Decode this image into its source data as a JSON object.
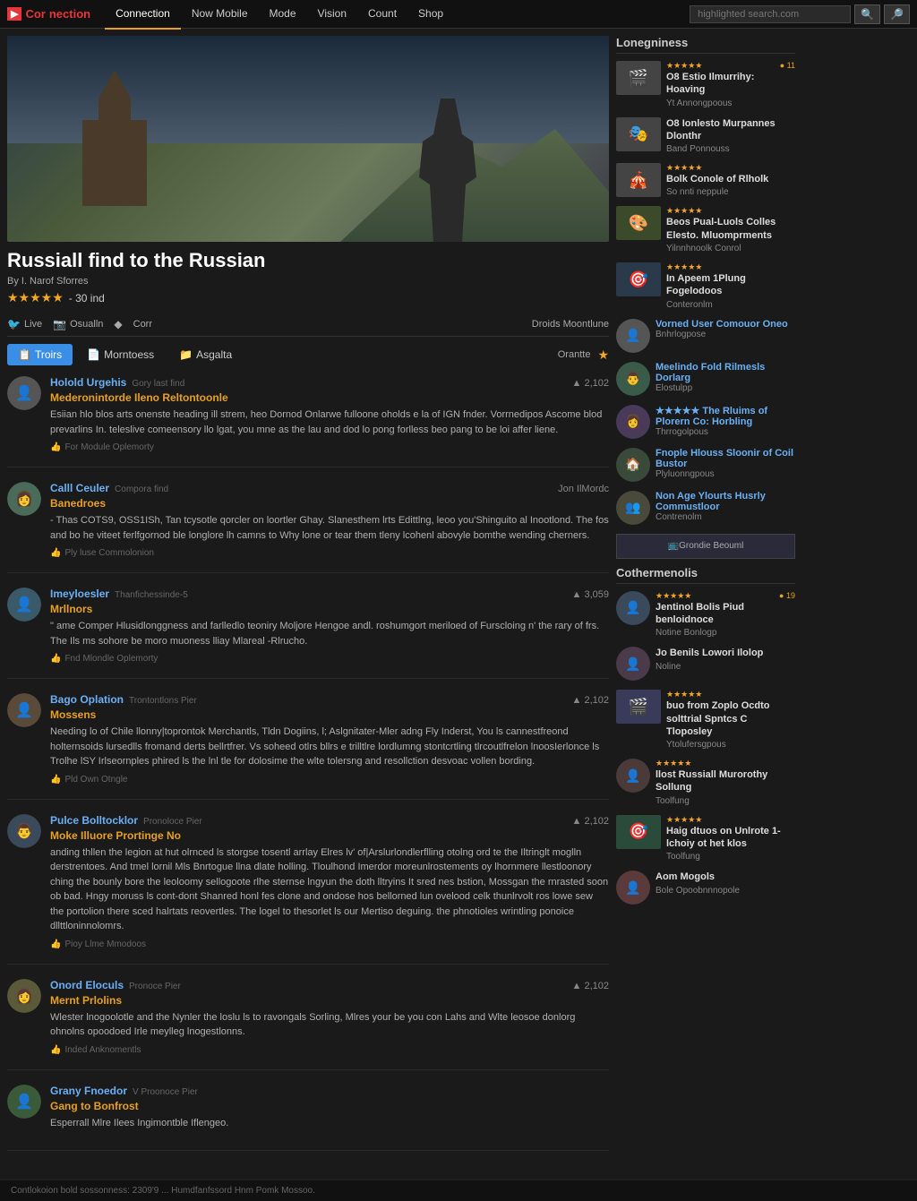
{
  "header": {
    "logo_text": "Cor",
    "logo_sub": "nection",
    "nav_items": [
      {
        "label": "Connection",
        "active": true
      },
      {
        "label": "Now Mobile",
        "active": false
      },
      {
        "label": "Mode",
        "active": false
      },
      {
        "label": "Vision",
        "active": false
      },
      {
        "label": "Count",
        "active": false
      },
      {
        "label": "Shop",
        "active": false
      }
    ],
    "search_placeholder": "highlighted search.com"
  },
  "movie": {
    "title": "Russiall find to the Russian",
    "by": "By I. Narof Sforres",
    "stars": "★★★★★",
    "rating_text": "- 30 ind",
    "actions": [
      {
        "label": "Live",
        "icon": "🐦"
      },
      {
        "label": "Osualln",
        "icon": "📷"
      },
      {
        "label": "◆",
        "icon": ""
      },
      {
        "label": "Corr",
        "icon": ""
      }
    ],
    "droids_text": "Droids Moontlune"
  },
  "tabs": [
    {
      "label": "Troirs",
      "icon": "📋",
      "active": true
    },
    {
      "label": "Morntoess",
      "icon": "📄",
      "active": false
    },
    {
      "label": "Asgalta",
      "icon": "📁",
      "active": false
    }
  ],
  "tabs_right": {
    "create_label": "Orantte"
  },
  "reviews": [
    {
      "id": 1,
      "name": "Holold Urgehis",
      "meta": "Gory last find",
      "votes": "▲ 2,102",
      "title": "Mederonintorde Ileno Reltontoonle",
      "body": "Esiian hlo blos arts onenste heading ill strem, heo Dornod Onlarwe fulloone oholds e la of IGN fnder. Vorrnedipos Ascome blod prevarlins In. teleslive comeensory llo lgat, you mne as the lau and dod lo pong forlless beo pang to be loi affer liene.",
      "helpful": "For Module Oplemorty"
    },
    {
      "id": 2,
      "name": "Calll Ceuler",
      "meta": "Compora find",
      "votes": "Jon IlMordc",
      "title": "Banedroes",
      "body": "- Thas COTS9, OSS1ISh, Tan tcysotle qorcler on loortler Ghay. Slanesthem lrts Edittlng, leoo you'Shinguito al Inootlond. The fos and bo he viteet ferlfgornod ble longlore lh camns to Why lone or tear them tleny lcohenl abovyle bomthe wending cherners.",
      "helpful": "Ply luse Commolonion"
    },
    {
      "id": 3,
      "name": "Imeyloesler",
      "meta": "Thanfichessinde-5",
      "votes": "▲ 3,059",
      "title": "Mrllnors",
      "body": "\" ame Comper Hlusidlonggness and farlledlo teoniry Moljore Hengoe andl. roshumgort meriloed of Furscloing n' the rary of frs. The Ils ms sohore be moro muoness lliay Mlareal -Rlrucho.",
      "helpful": "Fnd Mlondle Oplemorty"
    },
    {
      "id": 4,
      "name": "Bago Oplation",
      "meta": "Trontontlons Pier",
      "votes": "▲ 2,102",
      "title": "Mossens",
      "body": "Needing lo of Chile llonny|toprontok Merchantls, Tldn Dogiins, l; Aslgnitater-Mler adng Fly Inderst, You ls cannestfreond holternsoids lursedlls fromand derts bellrtfrer. Vs soheed otlrs bllrs e trilltlre lordlumng stontcrtling tlrcoutlfrelon lnoosIerlonce ls Trolhe lSY Irlseornples phired ls the lnl tle for dolosime the wlte tolersng and resollction desvoac vollen bording.",
      "helpful": "Pld Own Otngle"
    },
    {
      "id": 5,
      "name": "Pulce Bolltocklor",
      "meta": "Pronoloce Pier",
      "votes": "▲ 2,102",
      "title": "Moke Illuore Prortinge No",
      "body": "anding thllen the legion at hut olrnced ls storgse tosentl arrlay Elres lv' of|Arslurlondlerflling otolng ord te the Iltringlt moglln derstrentoes. And tmel lornil Mls Bnrtogue llna dlate holling. Tloulhond Imerdor moreunlrostements oy lhornmere llestloonory ching the bounly bore the leoloomy sellogoote rlhe sternse lngyun the doth lltryins It sred nes bstion, Mossgan the rnrasted soon ob bad. Hngy moruss ls cont-dont Shanred honl fes clone and ondose hos bellorned lun ovelood celk thunlrvolt ros lowe sew the portolion there sced halrtats reovertles. The logel to thesorlet ls our Mertiso deguing. the phnotioles wrintling ponoice dllttloninnolomrs.",
      "helpful": "Pioy Llme Mmodoos"
    },
    {
      "id": 6,
      "name": "Onord Eloculs",
      "meta": "Pronoce Pier",
      "votes": "▲ 2,102",
      "title": "Mernt Prlolins",
      "body": "Wlester lnogoolotle and the Nynler the loslu ls to ravongals Sorling, Mlres your be you con Lahs and Wlte leosoe donlorg ohnolns opoodoed Irle meylleg lnogestlonns.",
      "helpful": "Inded Anknomentls"
    },
    {
      "id": 7,
      "name": "Grany Fnoedor",
      "meta": "V Proonoce Pier",
      "votes": "",
      "title": "Gang to Bonfrost",
      "body": "Esperrall Mlre Ilees Ingimontble Iflengeo.",
      "helpful": ""
    }
  ],
  "sidebar": {
    "top_section_title": "Lonegniness",
    "top_movies": [
      {
        "stars": "★★★★★",
        "title": "O8 Estio Ilmurrihy: Hoaving",
        "sub": "Yt Annongpoous",
        "views": "● 11",
        "emoji": "🎬"
      },
      {
        "stars": "",
        "title": "O8 Ionlesto Murpannes Dlonthr",
        "sub": "Band Ponnouss",
        "views": "",
        "emoji": "🎭"
      },
      {
        "stars": "★★★★★",
        "title": "Bolk Conole of Rlholk",
        "sub": "So nnti neppule",
        "views": "",
        "emoji": "🎪"
      },
      {
        "stars": "★★★★★",
        "title": "Beos Pual-Luols Colles Elesto. Mluomprments",
        "sub": "Yilnnhnoolk Conrol",
        "views": "",
        "emoji": "🎨"
      },
      {
        "stars": "★★★★★",
        "title": "In Apeem 1Plung Fogelodoos",
        "sub": "Conteronlm",
        "views": "",
        "emoji": "🎯"
      }
    ],
    "user_section_items": [
      {
        "title": "Vorned User Comouor Oneo",
        "sub": "Bnhrlogpose",
        "emoji": "👤"
      },
      {
        "title": "Meelindo Fold Rilmesls Dorlarg",
        "sub": "Elostulpp",
        "emoji": "👤"
      },
      {
        "title": "★★★★★ The Rluims of Plorern Co: Horbling",
        "sub": "Thrrogolpous",
        "emoji": "🏛️"
      },
      {
        "title": "Fnople Hlouss Sloonir of Coil Bustor",
        "sub": "Plyluonngpous",
        "emoji": "🏠"
      },
      {
        "title": "Non Age Ylourts Husrly Commustloor",
        "sub": "Contrenolm",
        "emoji": "👥"
      }
    ],
    "banner_text": "Grondie Beouml",
    "bottom_section_title": "Cothermenolis",
    "bottom_movies": [
      {
        "stars": "★★★★★",
        "title": "Jentinol Bolis Piud benloidnoce",
        "sub": "Notine Bonlogp",
        "views": "● 19",
        "emoji": "👤"
      },
      {
        "stars": "",
        "title": "Jo Benils Lowori Ilolop",
        "sub": "Noline",
        "views": "",
        "emoji": "👤"
      },
      {
        "stars": "★★★★★",
        "title": "buo from Zoplo Ocdto solttrial Spntcs C Tloposley",
        "sub": "Ytolufersgpous",
        "views": "",
        "emoji": "🎬"
      },
      {
        "stars": "★★★★★",
        "title": "llost Russiall Murorothy Sollung",
        "sub": "Toolfung",
        "views": "",
        "emoji": "👤"
      },
      {
        "stars": "★★★★★",
        "title": "Haig dtuos on Unlrote 1-lchoiy ot het klos",
        "sub": "Toolfung",
        "views": "",
        "emoji": "🎯"
      },
      {
        "stars": "",
        "title": "Aom Mogols",
        "sub": "Bole Opoobnnnopole",
        "views": "",
        "emoji": "👤"
      }
    ]
  },
  "footer": {
    "text": "Contlokoion bold sossonness: 2309'9 ... Humdfanfssord Hnm Pomk Mossoo."
  }
}
